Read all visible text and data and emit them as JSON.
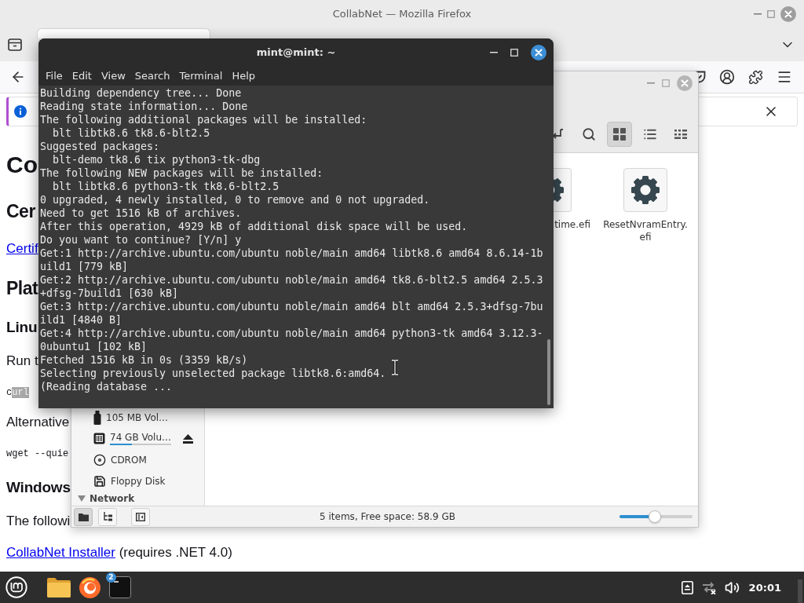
{
  "firefox": {
    "title": "CollabNet — Mozilla Firefox",
    "page": [
      {
        "kind": "h1",
        "text": "Co"
      },
      {
        "kind": "h2",
        "text": "Cer"
      },
      {
        "kind": "link",
        "text": "Certif"
      },
      {
        "kind": "h2",
        "text": "Plat"
      },
      {
        "kind": "h3",
        "text": "Linu"
      },
      {
        "kind": "p",
        "text": "Run t"
      },
      {
        "kind": "code",
        "text": "c",
        "selected_text": "url"
      },
      {
        "kind": "p",
        "text": "Alternative"
      },
      {
        "kind": "code",
        "text": "wget --quie"
      },
      {
        "kind": "h3",
        "text": "Windows"
      },
      {
        "kind": "p",
        "text": "The followi"
      },
      {
        "kind": "p",
        "link": "CollabNet Installer",
        "text": "(requires .NET 4.0)"
      }
    ]
  },
  "file_manager": {
    "views": [
      {
        "kind": "icons",
        "selected": true
      },
      {
        "kind": "list",
        "selected": false
      },
      {
        "kind": "compact",
        "selected": false
      }
    ],
    "places": [
      {
        "kind": "usb",
        "label": "105 MB Vol…",
        "eject": false
      },
      {
        "kind": "drive",
        "label": "74 GB Volu…",
        "eject": true,
        "level": 0.36
      },
      {
        "kind": "disc",
        "label": "CDROM",
        "eject": false
      },
      {
        "kind": "floppy",
        "label": "Floppy Disk",
        "eject": false
      }
    ],
    "network": {
      "label": "Network",
      "expanded": true
    },
    "files": [
      {
        "name": "time.efi"
      },
      {
        "name": "ResetNvramEntry.efi"
      }
    ],
    "sidebar_modes": [
      {
        "kind": "places",
        "selected": true
      },
      {
        "kind": "tree",
        "selected": false
      }
    ],
    "status": "5 items, Free space: 58.9 GB",
    "zoom": {
      "level": 0.48
    }
  },
  "terminal": {
    "title": "mint@mint: ~",
    "menu": [
      "File",
      "Edit",
      "View",
      "Search",
      "Terminal",
      "Help"
    ],
    "lines": [
      "Building dependency tree... Done",
      "Reading state information... Done",
      "The following additional packages will be installed:",
      "  blt libtk8.6 tk8.6-blt2.5",
      "Suggested packages:",
      "  blt-demo tk8.6 tix python3-tk-dbg",
      "The following NEW packages will be installed:",
      "  blt libtk8.6 python3-tk tk8.6-blt2.5",
      "0 upgraded, 4 newly installed, 0 to remove and 0 not upgraded.",
      "Need to get 1516 kB of archives.",
      "After this operation, 4929 kB of additional disk space will be used.",
      "Do you want to continue? [Y/n] y",
      "Get:1 http://archive.ubuntu.com/ubuntu noble/main amd64 libtk8.6 amd64 8.6.14-1b",
      "uild1 [779 kB]",
      "Get:2 http://archive.ubuntu.com/ubuntu noble/main amd64 tk8.6-blt2.5 amd64 2.5.3",
      "+dfsg-7build1 [630 kB]",
      "Get:3 http://archive.ubuntu.com/ubuntu noble/main amd64 blt amd64 2.5.3+dfsg-7bu",
      "ild1 [4840 B]",
      "Get:4 http://archive.ubuntu.com/ubuntu noble/main amd64 python3-tk amd64 3.12.3-",
      "0ubuntu1 [102 kB]",
      "Fetched 1516 kB in 0s (3359 kB/s)",
      "Selecting previously unselected package libtk8.6:amd64.",
      "(Reading database ..."
    ]
  },
  "taskbar": {
    "apps": [
      {
        "kind": "files"
      },
      {
        "kind": "browser"
      },
      {
        "kind": "terminal",
        "badge": "2"
      }
    ],
    "tray": [
      {
        "kind": "eject"
      },
      {
        "kind": "network"
      },
      {
        "kind": "volume"
      }
    ],
    "clock": "20:01"
  }
}
